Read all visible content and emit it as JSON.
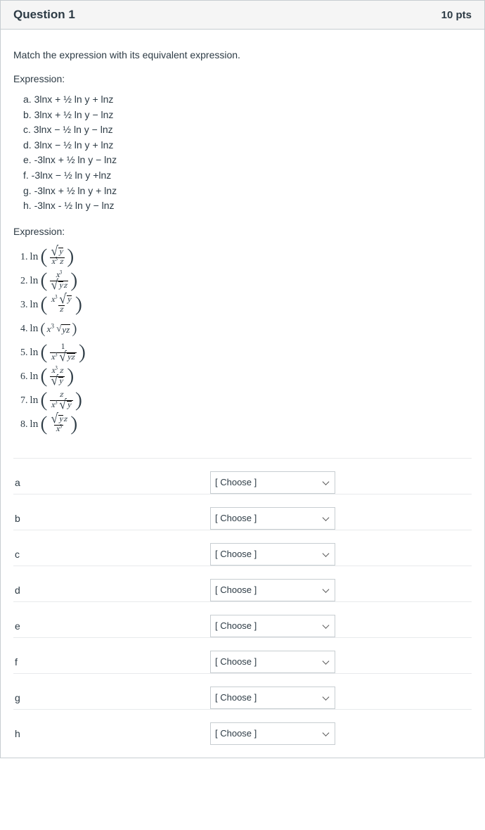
{
  "header": {
    "title": "Question 1",
    "points": "10 pts"
  },
  "instruction": "Match the expression with its equivalent expression.",
  "expression_label": "Expression:",
  "letter_expressions": [
    {
      "id": "a",
      "text": "a. 3lnx + ½ ln y + lnz"
    },
    {
      "id": "b",
      "text": "b. 3lnx + ½ ln y − lnz"
    },
    {
      "id": "c",
      "text": "c. 3lnx − ½ ln y − lnz"
    },
    {
      "id": "d",
      "text": "d. 3lnx − ½ ln y + lnz"
    },
    {
      "id": "e",
      "text": "e. -3lnx + ½ ln y − lnz"
    },
    {
      "id": "f",
      "text": "f. -3lnx − ½ ln y +lnz"
    },
    {
      "id": "g",
      "text": "g. -3lnx + ½ ln y + lnz"
    },
    {
      "id": "h",
      "text": "h. -3lnx - ½ ln y − lnz"
    }
  ],
  "numbered_expressions": [
    {
      "n": "1.",
      "desc": "ln(√y / (x³ z))"
    },
    {
      "n": "2.",
      "desc": "ln(x³ / (√y z))"
    },
    {
      "n": "3.",
      "desc": "ln((x³ √y) / z)"
    },
    {
      "n": "4.",
      "desc": "ln(x³ √(y z))"
    },
    {
      "n": "5.",
      "desc": "ln(1 / (x³ √(y z)))"
    },
    {
      "n": "6.",
      "desc": "ln((x³ z) / √y)"
    },
    {
      "n": "7.",
      "desc": "ln(z / (x³ √y))"
    },
    {
      "n": "8.",
      "desc": "ln((√y z) / x³)"
    }
  ],
  "match_rows": [
    {
      "label": "a"
    },
    {
      "label": "b"
    },
    {
      "label": "c"
    },
    {
      "label": "d"
    },
    {
      "label": "e"
    },
    {
      "label": "f"
    },
    {
      "label": "g"
    },
    {
      "label": "h"
    }
  ],
  "select_placeholder": "[ Choose ]"
}
